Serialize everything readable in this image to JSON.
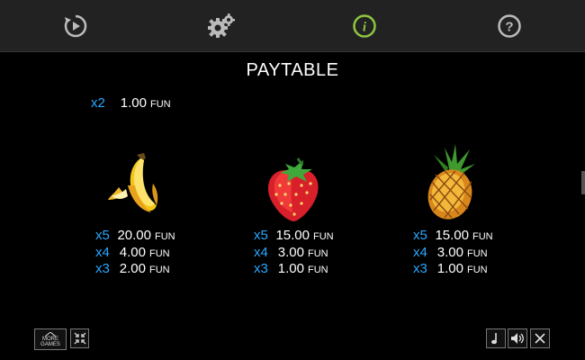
{
  "topbar": {
    "icons": [
      "autoplay-icon",
      "settings-icon",
      "info-icon",
      "help-icon"
    ],
    "active_color": "#8dc63f"
  },
  "title": "PAYTABLE",
  "top_entry": {
    "mult": "x2",
    "value": "1.00",
    "unit": "FUN"
  },
  "symbols": [
    {
      "name": "banana-icon",
      "rows": [
        {
          "mult": "x5",
          "value": "20.00",
          "unit": "FUN"
        },
        {
          "mult": "x4",
          "value": "4.00",
          "unit": "FUN"
        },
        {
          "mult": "x3",
          "value": "2.00",
          "unit": "FUN"
        }
      ]
    },
    {
      "name": "strawberry-icon",
      "rows": [
        {
          "mult": "x5",
          "value": "15.00",
          "unit": "FUN"
        },
        {
          "mult": "x4",
          "value": "3.00",
          "unit": "FUN"
        },
        {
          "mult": "x3",
          "value": "1.00",
          "unit": "FUN"
        }
      ]
    },
    {
      "name": "pineapple-icon",
      "rows": [
        {
          "mult": "x5",
          "value": "15.00",
          "unit": "FUN"
        },
        {
          "mult": "x4",
          "value": "3.00",
          "unit": "FUN"
        },
        {
          "mult": "x3",
          "value": "1.00",
          "unit": "FUN"
        }
      ]
    }
  ],
  "bottom": {
    "more_games_line1": "MORE",
    "more_games_line2": "GAMES"
  },
  "colors": {
    "multiplier": "#2aa7ff",
    "accent": "#8dc63f"
  }
}
